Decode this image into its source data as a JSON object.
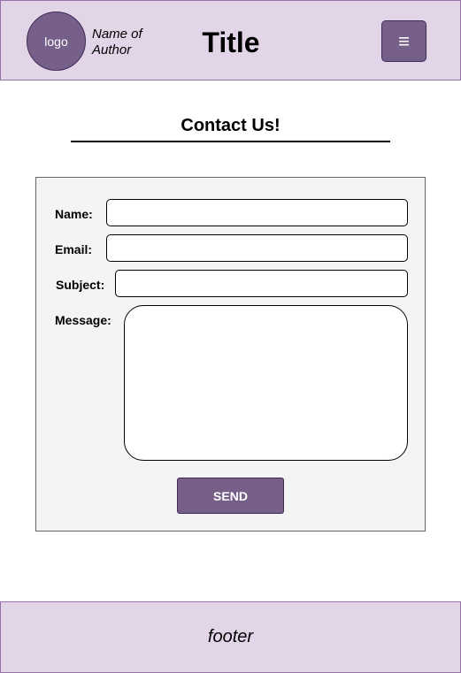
{
  "header": {
    "logo_text": "logo",
    "author_line1": "Name of",
    "author_line2": "Author",
    "title": "Title",
    "menu_icon": "hamburger-menu-icon",
    "menu_glyph": "≡"
  },
  "contact": {
    "heading": "Contact Us!",
    "name_label": "Name:",
    "name_value": "",
    "email_label": "Email:",
    "email_value": "",
    "subject_label": "Subject:",
    "subject_value": "",
    "message_label": "Message:",
    "message_value": "",
    "send_label": "SEND"
  },
  "footer": {
    "text": "footer"
  },
  "colors": {
    "header_bg": "#e1d5e7",
    "header_border": "#9673a6",
    "accent": "#76608a",
    "accent_border": "#432d57",
    "panel_bg": "#f4f4f4"
  }
}
